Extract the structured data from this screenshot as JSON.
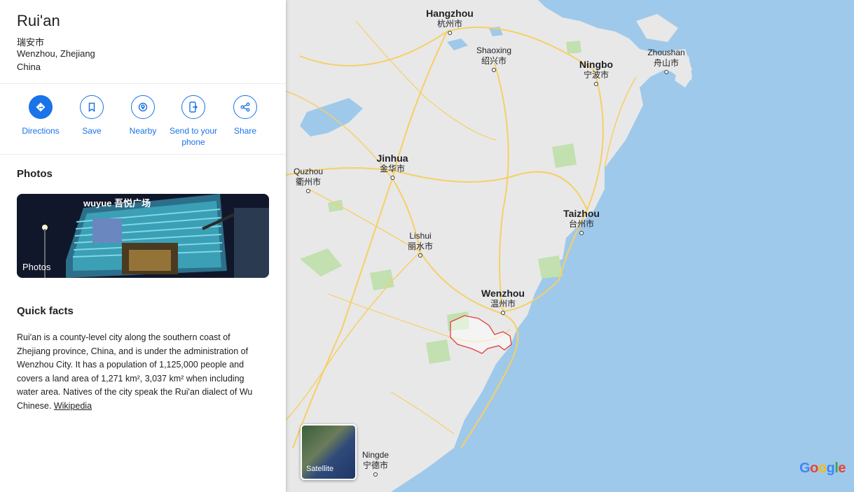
{
  "place": {
    "title": "Rui'an",
    "native_name": "瑞安市",
    "region": "Wenzhou, Zhejiang",
    "country": "China"
  },
  "actions": [
    {
      "label": "Directions",
      "icon": "directions-icon"
    },
    {
      "label": "Save",
      "icon": "bookmark-icon"
    },
    {
      "label": "Nearby",
      "icon": "nearby-icon"
    },
    {
      "label": "Send to your phone",
      "icon": "send-to-phone-icon"
    },
    {
      "label": "Share",
      "icon": "share-icon"
    }
  ],
  "photos": {
    "heading": "Photos",
    "thumb_label": "Photos",
    "sign_text": "wuyue 吾悦广场"
  },
  "quick_facts": {
    "heading": "Quick facts",
    "text": "Rui'an is a county-level city along the southern coast of Zhejiang province, China, and is under the administration of Wenzhou City. It has a population of 1,125,000 people and covers a land area of 1,271 km², 3,037 km² when including water area. Natives of the city speak the Rui'an dialect of Wu Chinese.",
    "link_text": "Wikipedia"
  },
  "map": {
    "cities": [
      {
        "en": "Hangzhou",
        "zh": "杭州市",
        "major": true
      },
      {
        "en": "Shaoxing",
        "zh": "绍兴市",
        "major": false
      },
      {
        "en": "Ningbo",
        "zh": "宁波市",
        "major": true
      },
      {
        "en": "Zhoushan",
        "zh": "舟山市",
        "major": false
      },
      {
        "en": "Jinhua",
        "zh": "金华市",
        "major": true
      },
      {
        "en": "Quzhou",
        "zh": "衢州市",
        "major": false
      },
      {
        "en": "Taizhou",
        "zh": "台州市",
        "major": true
      },
      {
        "en": "Lishui",
        "zh": "丽水市",
        "major": false
      },
      {
        "en": "Wenzhou",
        "zh": "温州市",
        "major": true
      },
      {
        "en": "Ningde",
        "zh": "宁德市",
        "major": false
      }
    ],
    "satellite_label": "Satellite",
    "logo": "Google",
    "colors": {
      "water": "#9fc9ea",
      "land": "#e8e8e8",
      "road": "#f6cf65",
      "park": "#c2e0b0",
      "boundary": "#e33c3c"
    }
  }
}
